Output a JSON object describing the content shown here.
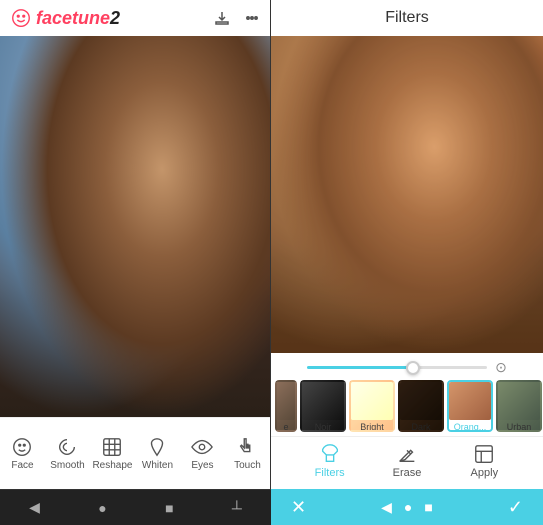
{
  "app": {
    "name": "facetune2",
    "logo_prefix": "face",
    "logo_suffix": "tune2"
  },
  "left_header": {
    "download_icon": "download-icon",
    "more_icon": "more-icon"
  },
  "right_header": {
    "title": "Filters"
  },
  "tools": [
    {
      "id": "face",
      "label": "Face",
      "icon": "face-icon"
    },
    {
      "id": "smooth",
      "label": "Smooth",
      "icon": "smooth-icon"
    },
    {
      "id": "reshape",
      "label": "Reshape",
      "icon": "reshape-icon"
    },
    {
      "id": "whiten",
      "label": "Whiten",
      "icon": "whiten-icon"
    },
    {
      "id": "eyes",
      "label": "Eyes",
      "icon": "eyes-icon"
    },
    {
      "id": "touch",
      "label": "Touch",
      "icon": "touch-icon"
    }
  ],
  "filters": [
    {
      "id": "original",
      "label": "e",
      "class": "ft-original",
      "active": false
    },
    {
      "id": "noir",
      "label": "Noir",
      "class": "ft-noir",
      "active": false
    },
    {
      "id": "bright",
      "label": "Bright",
      "class": "ft-bright",
      "active": false
    },
    {
      "id": "dark",
      "label": "Dark",
      "class": "ft-dark",
      "active": false
    },
    {
      "id": "orange",
      "label": "Orang...",
      "class": "ft-orange",
      "active": true
    },
    {
      "id": "urban",
      "label": "Urban",
      "class": "ft-urban",
      "active": false
    }
  ],
  "filter_actions": [
    {
      "id": "filters",
      "label": "Filters",
      "active": true
    },
    {
      "id": "erase",
      "label": "Erase",
      "active": false
    },
    {
      "id": "apply",
      "label": "Apply",
      "active": false
    }
  ],
  "bottom_left": {
    "back_icon": "back-icon",
    "home_icon": "home-icon",
    "square_icon": "square-icon",
    "menu_icon": "menu-icon"
  },
  "bottom_right": {
    "cancel_label": "✕",
    "confirm_label": "✓"
  },
  "colors": {
    "accent": "#4ad0e4",
    "logo_red": "#ff4060",
    "bg_dark": "#1a1a1a",
    "text_dark": "#333"
  }
}
